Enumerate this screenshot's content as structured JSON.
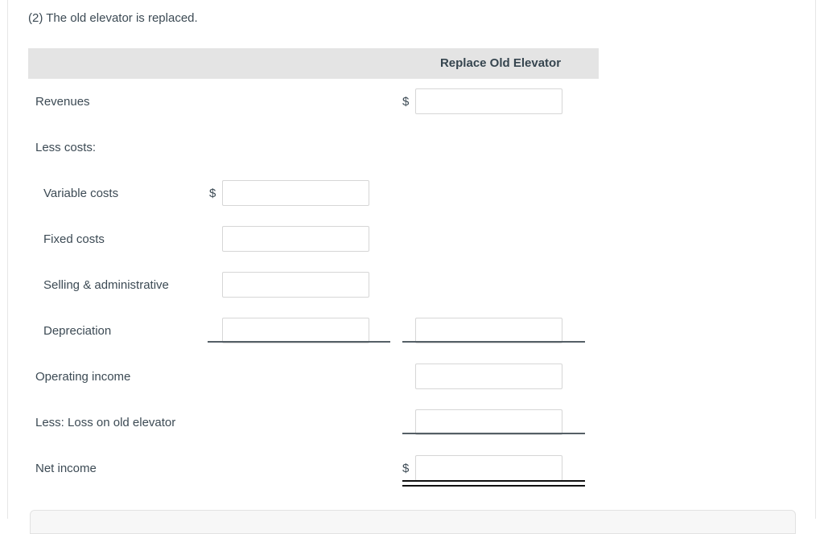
{
  "page": {
    "question_text": "(2) The old elevator is replaced."
  },
  "table": {
    "column_headers": {
      "label_col": "",
      "mid_col": "",
      "right_col": "Replace Old Elevator"
    },
    "currency_symbol": "$",
    "input_placeholder": "",
    "rows": [
      {
        "label": "Revenues",
        "indent": false,
        "mid": {
          "show_input": false,
          "show_dollar": false,
          "value": ""
        },
        "right": {
          "show_input": true,
          "show_dollar": true,
          "value": ""
        }
      },
      {
        "label": "Less costs:",
        "indent": false,
        "mid": {
          "show_input": false,
          "show_dollar": false,
          "value": ""
        },
        "right": {
          "show_input": false,
          "show_dollar": false,
          "value": ""
        }
      },
      {
        "label": "Variable costs",
        "indent": true,
        "mid": {
          "show_input": true,
          "show_dollar": true,
          "value": ""
        },
        "right": {
          "show_input": false,
          "show_dollar": false,
          "value": ""
        }
      },
      {
        "label": "Fixed costs",
        "indent": true,
        "mid": {
          "show_input": true,
          "show_dollar": false,
          "value": ""
        },
        "right": {
          "show_input": false,
          "show_dollar": false,
          "value": ""
        }
      },
      {
        "label": "Selling & administrative",
        "indent": true,
        "mid": {
          "show_input": true,
          "show_dollar": false,
          "value": ""
        },
        "right": {
          "show_input": false,
          "show_dollar": false,
          "value": ""
        }
      },
      {
        "label": "Depreciation",
        "indent": true,
        "mid": {
          "show_input": true,
          "show_dollar": false,
          "value": ""
        },
        "right": {
          "show_input": true,
          "show_dollar": false,
          "value": ""
        }
      },
      {
        "label": "Operating income",
        "indent": false,
        "mid": {
          "show_input": false,
          "show_dollar": false,
          "value": ""
        },
        "right": {
          "show_input": true,
          "show_dollar": false,
          "value": ""
        }
      },
      {
        "label": "Less: Loss on old elevator",
        "indent": false,
        "mid": {
          "show_input": false,
          "show_dollar": false,
          "value": ""
        },
        "right": {
          "show_input": true,
          "show_dollar": false,
          "value": ""
        }
      },
      {
        "label": "Net income",
        "indent": false,
        "mid": {
          "show_input": false,
          "show_dollar": false,
          "value": ""
        },
        "right": {
          "show_input": true,
          "show_dollar": true,
          "value": ""
        }
      }
    ]
  },
  "colors": {
    "header_background": "#e4e4e4",
    "header_text": "#36454f",
    "body_text": "#3c4a54",
    "input_border": "#d6d6d6",
    "rule": "#555f66",
    "total_rule": "#111111",
    "page_border": "#e6e6e6"
  }
}
